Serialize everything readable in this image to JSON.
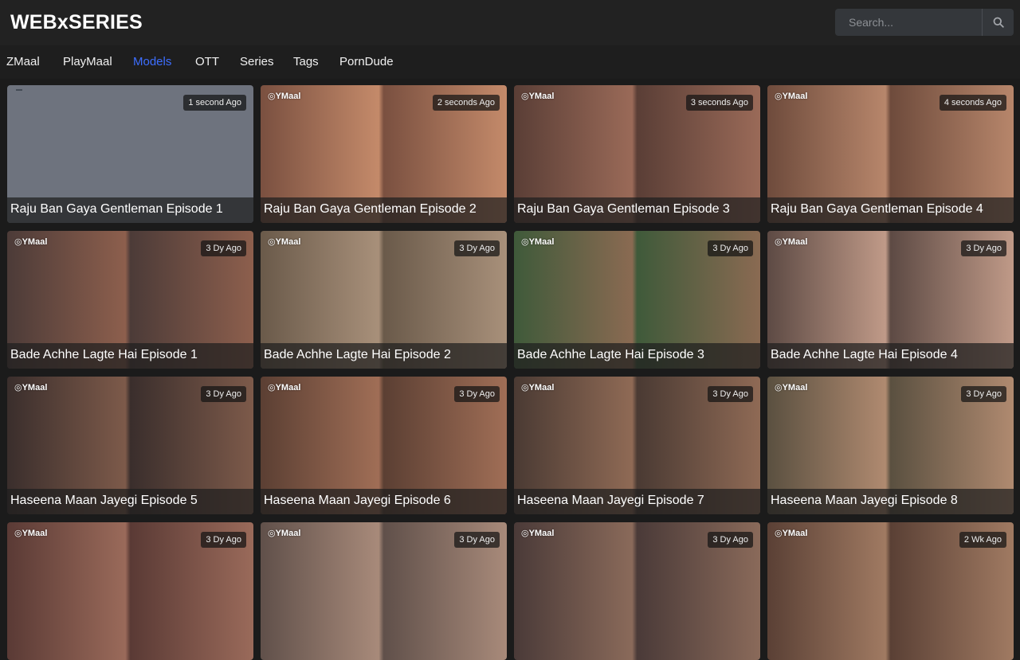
{
  "site": {
    "logo": "WEBxSERIES"
  },
  "search": {
    "placeholder": "Search..."
  },
  "nav": [
    "ZMaal",
    "PlayMaal",
    "Models",
    "OTT",
    "Series",
    "Tags",
    "PornDude"
  ],
  "nav_active": "Models",
  "watermark": "YMaal",
  "colors": {
    "accent": "#3d6eff",
    "background": "#1b1b1b",
    "header": "#222222"
  },
  "videos": [
    {
      "title": "Raju Ban Gaya Gentleman Episode 1",
      "time": "1 second Ago",
      "icon": "placeholder-thumbnail"
    },
    {
      "title": "Raju Ban Gaya Gentleman Episode 2",
      "time": "2 seconds Ago"
    },
    {
      "title": "Raju Ban Gaya Gentleman Episode 3",
      "time": "3 seconds Ago"
    },
    {
      "title": "Raju Ban Gaya Gentleman Episode 4",
      "time": "4 seconds Ago"
    },
    {
      "title": "Bade Achhe Lagte Hai Episode 1",
      "time": "3 Dy Ago"
    },
    {
      "title": "Bade Achhe Lagte Hai Episode 2",
      "time": "3 Dy Ago"
    },
    {
      "title": "Bade Achhe Lagte Hai Episode 3",
      "time": "3 Dy Ago"
    },
    {
      "title": "Bade Achhe Lagte Hai Episode 4",
      "time": "3 Dy Ago"
    },
    {
      "title": "Haseena Maan Jayegi Episode 5",
      "time": "3 Dy Ago"
    },
    {
      "title": "Haseena Maan Jayegi Episode 6",
      "time": "3 Dy Ago"
    },
    {
      "title": "Haseena Maan Jayegi Episode 7",
      "time": "3 Dy Ago"
    },
    {
      "title": "Haseena Maan Jayegi Episode 8",
      "time": "3 Dy Ago"
    },
    {
      "title": "",
      "time": "3 Dy Ago"
    },
    {
      "title": "",
      "time": "3 Dy Ago"
    },
    {
      "title": "",
      "time": "3 Dy Ago"
    },
    {
      "title": "",
      "time": "2 Wk Ago"
    }
  ]
}
